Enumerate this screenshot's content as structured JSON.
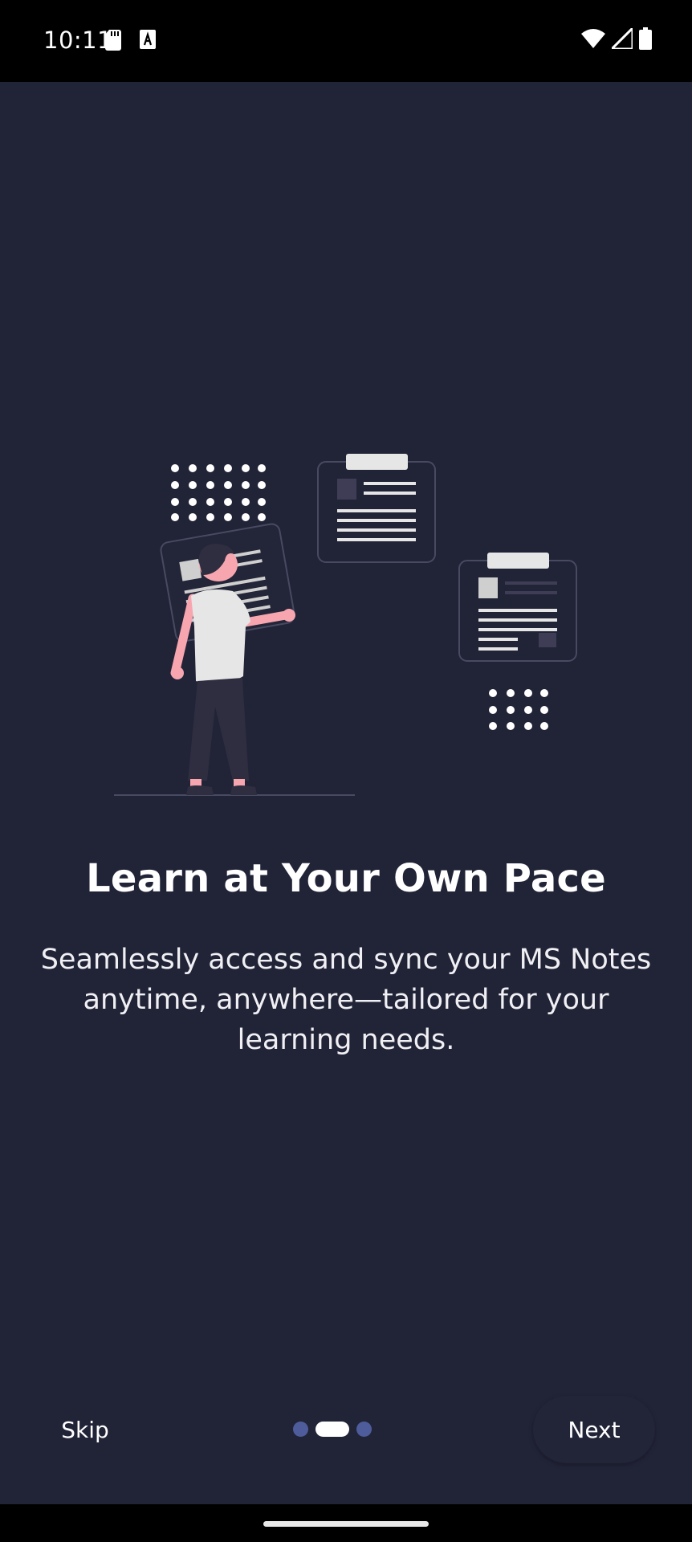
{
  "status_bar": {
    "time": "10:11",
    "icons": [
      "sd-card-icon",
      "font-a-icon",
      "wifi-icon",
      "signal-icon",
      "battery-icon"
    ]
  },
  "onboarding": {
    "title": "Learn at Your Own Pace",
    "description": "Seamlessly access and sync your MS Notes anytime, anywhere—tailored for your learning needs.",
    "page_indicator": {
      "total": 3,
      "current": 2
    }
  },
  "footer": {
    "skip_label": "Skip",
    "next_label": "Next"
  },
  "colors": {
    "background": "#212337",
    "indicator_inactive": "#4e5c9b",
    "indicator_active": "#ffffff",
    "accent_skin": "#f7a6b0"
  }
}
